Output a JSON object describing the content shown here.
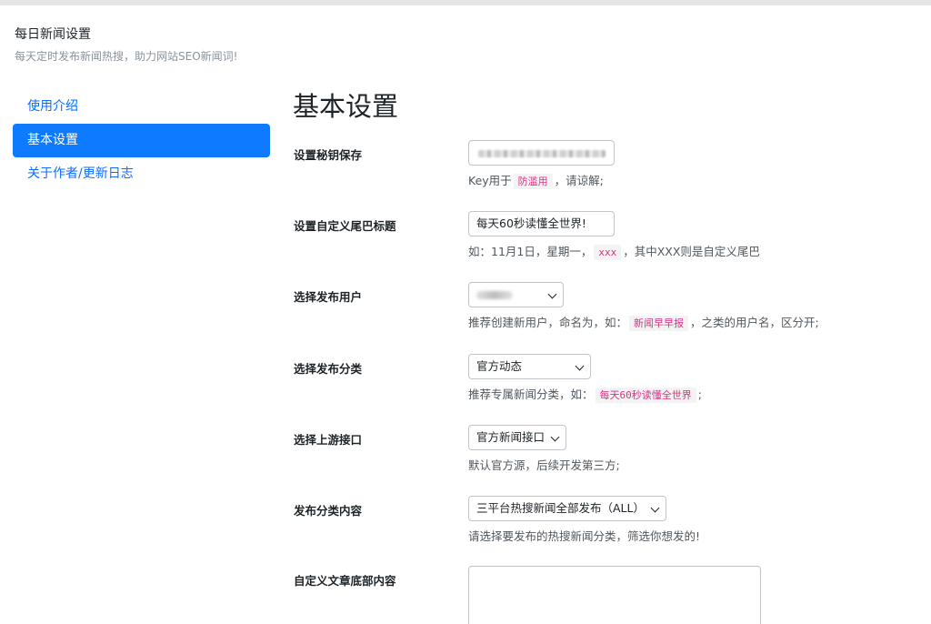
{
  "header": {
    "title": "每日新闻设置",
    "subtitle": "每天定时发布新闻热搜，助力网站SEO新闻词!"
  },
  "sidebar": {
    "items": [
      {
        "label": "使用介绍",
        "active": false
      },
      {
        "label": "基本设置",
        "active": true
      },
      {
        "label": "关于作者/更新日志",
        "active": false
      }
    ]
  },
  "main": {
    "page_title": "基本设置",
    "fields": {
      "key": {
        "label": "设置秘钥保存",
        "desc_prefix": "Key用于",
        "desc_code": "防滥用",
        "desc_suffix": "，请谅解;"
      },
      "tail_title": {
        "label": "设置自定义尾巴标题",
        "value": "每天60秒读懂全世界!",
        "desc_prefix": "如：11月1日，星期一，",
        "desc_code": "xxx",
        "desc_suffix": "，其中XXX则是自定义尾巴"
      },
      "publish_user": {
        "label": "选择发布用户",
        "desc_prefix": "推荐创建新用户，命名为，如：",
        "desc_code": "新闻早早报",
        "desc_suffix": "，之类的用户名，区分开;"
      },
      "publish_category": {
        "label": "选择发布分类",
        "selected": "官方动态",
        "desc_prefix": "推荐专属新闻分类，如：",
        "desc_code": "每天60秒读懂全世界",
        "desc_suffix": ";"
      },
      "upstream_api": {
        "label": "选择上游接口",
        "selected": "官方新闻接口",
        "desc": "默认官方源，后续开发第三方;"
      },
      "publish_content": {
        "label": "发布分类内容",
        "selected": "三平台热搜新闻全部发布（ALL）",
        "desc": "请选择要发布的热搜新闻分类，筛选你想发的!"
      },
      "footer_content": {
        "label": "自定义文章底部内容",
        "value": ""
      }
    }
  },
  "colors": {
    "accent": "#0d7aff",
    "link": "#0d6efd",
    "code_text": "#d63384"
  }
}
